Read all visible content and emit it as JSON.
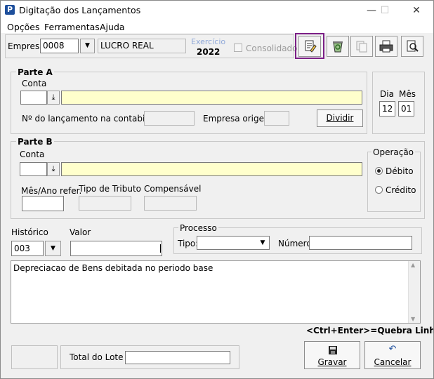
{
  "window": {
    "title": "Digitação dos Lançamentos",
    "minimize": "—",
    "maximize": "☐",
    "close": "✕"
  },
  "menu": [
    "Opções",
    "Ferramentas",
    "Ajuda"
  ],
  "top": {
    "empresa_label": "Empresa:",
    "empresa_code": "0008",
    "empresa_name": "LUCRO REAL",
    "exercicio_label": "Exercício",
    "exercicio_year": "2022",
    "consolidado_label": "Consolidado"
  },
  "toolbar": [
    "edit-document-icon",
    "recycle-icon",
    "copy-document-icon",
    "printer-icon",
    "preview-magnifier-icon"
  ],
  "parte_a": {
    "title": "Parte A",
    "conta_label": "Conta",
    "conta_code": "",
    "conta_desc": "",
    "num_lancamento_label": "Nº do lançamento na contabilidade:",
    "num_lancamento_value": "",
    "empresa_origem_label": "Empresa origem:",
    "empresa_origem_value": "",
    "dividir_label": "Dividir"
  },
  "date": {
    "dia_label": "Dia",
    "mes_label": "Mês",
    "dia_value": "12",
    "mes_value": "01"
  },
  "parte_b": {
    "title": "Parte B",
    "conta_label": "Conta",
    "conta_code": "",
    "conta_desc": "",
    "mesano_label": "Mês/Ano refer.",
    "mesano_value": "",
    "tipo_tributo_label": "Tipo de Tributo",
    "tipo_tributo_value": "",
    "compensavel_label": "Compensável",
    "compensavel_value": ""
  },
  "operacao": {
    "title": "Operação",
    "debito": "Débito",
    "credito": "Crédito",
    "selected": "debito"
  },
  "historico": {
    "label": "Histórico",
    "value": "003"
  },
  "valor": {
    "label": "Valor",
    "value": ""
  },
  "processo": {
    "title": "Processo",
    "tipo_label": "Tipo:",
    "tipo_value": "",
    "numero_label": "Número:",
    "numero_value": ""
  },
  "memo_text": "Depreciacao de Bens debitada no periodo base",
  "hint": "<Ctrl+Enter>=Quebra Linha",
  "bottom": {
    "total_lote_label": "Total do Lote",
    "total_lote_value": "",
    "gravar": "Gravar",
    "cancelar": "Cancelar"
  },
  "colors": {
    "accent_highlight": "#7b1f86",
    "yellow_field": "#ffffcc",
    "exercicio": "#8fa8d8"
  }
}
